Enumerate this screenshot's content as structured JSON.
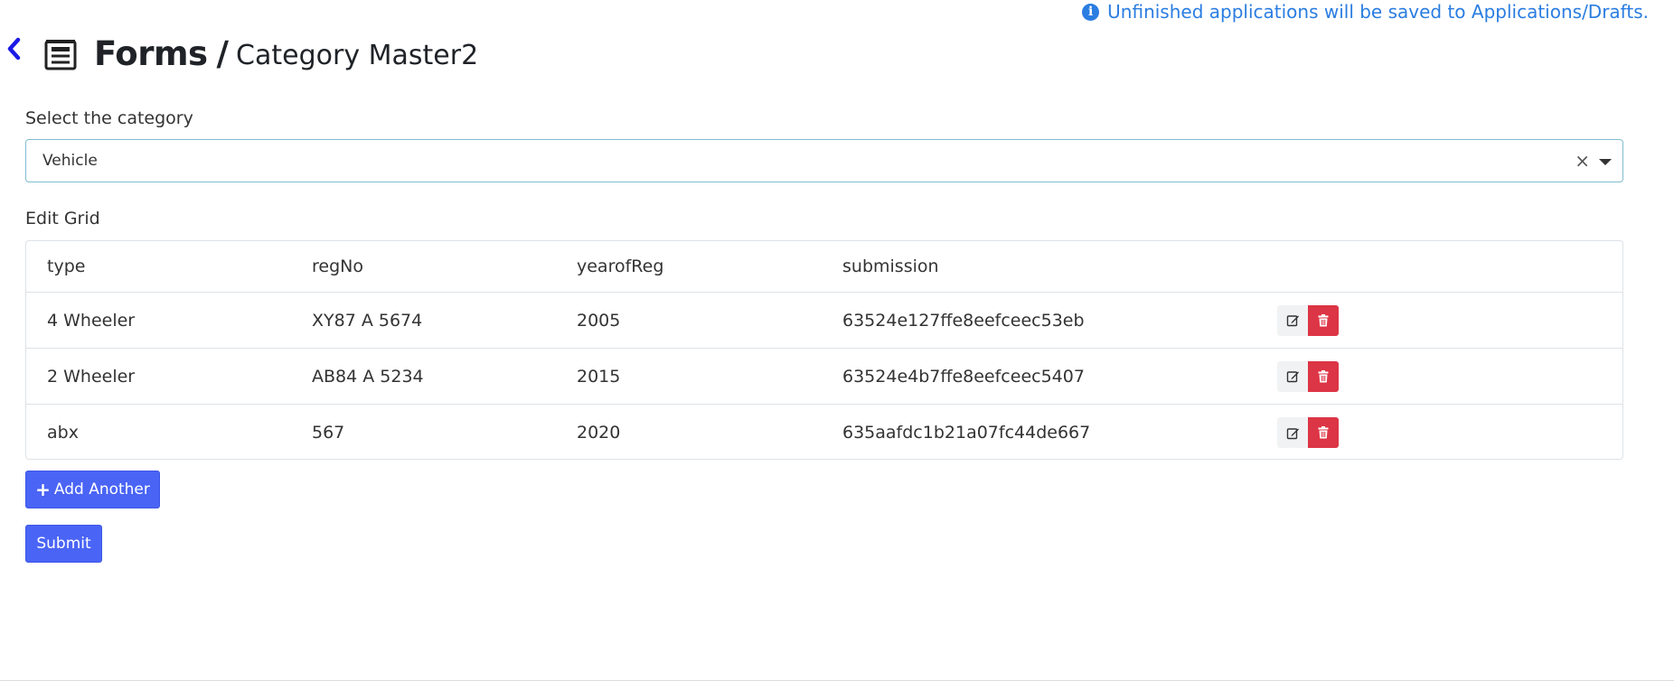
{
  "notice": {
    "icon": "info-icon",
    "text": "Unfinished applications will be saved to Applications/Drafts."
  },
  "header": {
    "back_icon": "chevron-left-icon",
    "form_icon": "form-icon",
    "title": "Forms",
    "separator": "/",
    "subtitle": "Category Master2"
  },
  "category": {
    "label": "Select the category",
    "selected": "Vehicle",
    "clear_glyph": "×"
  },
  "grid": {
    "label": "Edit Grid",
    "columns": [
      "type",
      "regNo",
      "yearofReg",
      "submission"
    ],
    "rows": [
      {
        "type": "4 Wheeler",
        "regNo": "XY87 A 5674",
        "yearofReg": "2005",
        "submission": "63524e127ffe8eefceec53eb"
      },
      {
        "type": "2 Wheeler",
        "regNo": "AB84 A 5234",
        "yearofReg": "2015",
        "submission": "63524e4b7ffe8eefceec5407"
      },
      {
        "type": "abx",
        "regNo": "567",
        "yearofReg": "2020",
        "submission": "635aafdc1b21a07fc44de667"
      }
    ]
  },
  "buttons": {
    "add_another": "Add Another",
    "add_icon": "plus-icon",
    "submit": "Submit"
  },
  "colors": {
    "accent": "#4a64f5",
    "info": "#2a7de1",
    "danger": "#dc3545",
    "back_arrow": "#1a1ae6"
  }
}
